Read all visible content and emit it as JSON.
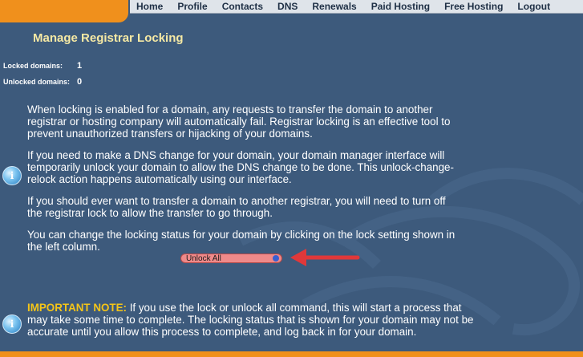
{
  "nav": {
    "items": [
      "Home",
      "Profile",
      "Contacts",
      "DNS",
      "Renewals",
      "Paid Hosting",
      "Free Hosting",
      "Logout"
    ]
  },
  "page_title": "Manage Registrar Locking",
  "stats": {
    "locked_label": "Locked domains:",
    "locked_value": "1",
    "unlocked_label": "Unlocked domains:",
    "unlocked_value": "0"
  },
  "paragraphs": [
    "When locking is enabled for a domain, any requests to transfer the domain to another registrar or hosting company will automatically fail. Registrar locking is an effective tool to prevent unauthorized transfers or hijacking of your domains.",
    "If you need to make a DNS change for your domain, your domain manager interface will temporarily unlock your domain to allow the DNS change to be done. This unlock-change-relock action happens automatically using our interface.",
    "If you should ever want to transfer a domain to another registrar, you will need to turn off the registrar lock to allow the transfer to go through.",
    "You can change the locking status for your domain by clicking on the lock setting shown in the left column."
  ],
  "unlock_button": "Unlock All",
  "note": {
    "label": "IMPORTANT NOTE:",
    "text": " If you use the lock or unlock all command, this will start a process that may take some time to complete. The locking status that is shown for your domain may not be accurate until you allow this process to complete, and log back in for your domain."
  },
  "icons": {
    "info": "info-icon",
    "arrow": "red-arrow-icon"
  },
  "colors": {
    "background": "#3d5a7c",
    "accent_orange": "#f0901c",
    "title_yellow": "#f6e9a4",
    "note_yellow": "#f5c518",
    "arrow_red": "#e0383a"
  }
}
